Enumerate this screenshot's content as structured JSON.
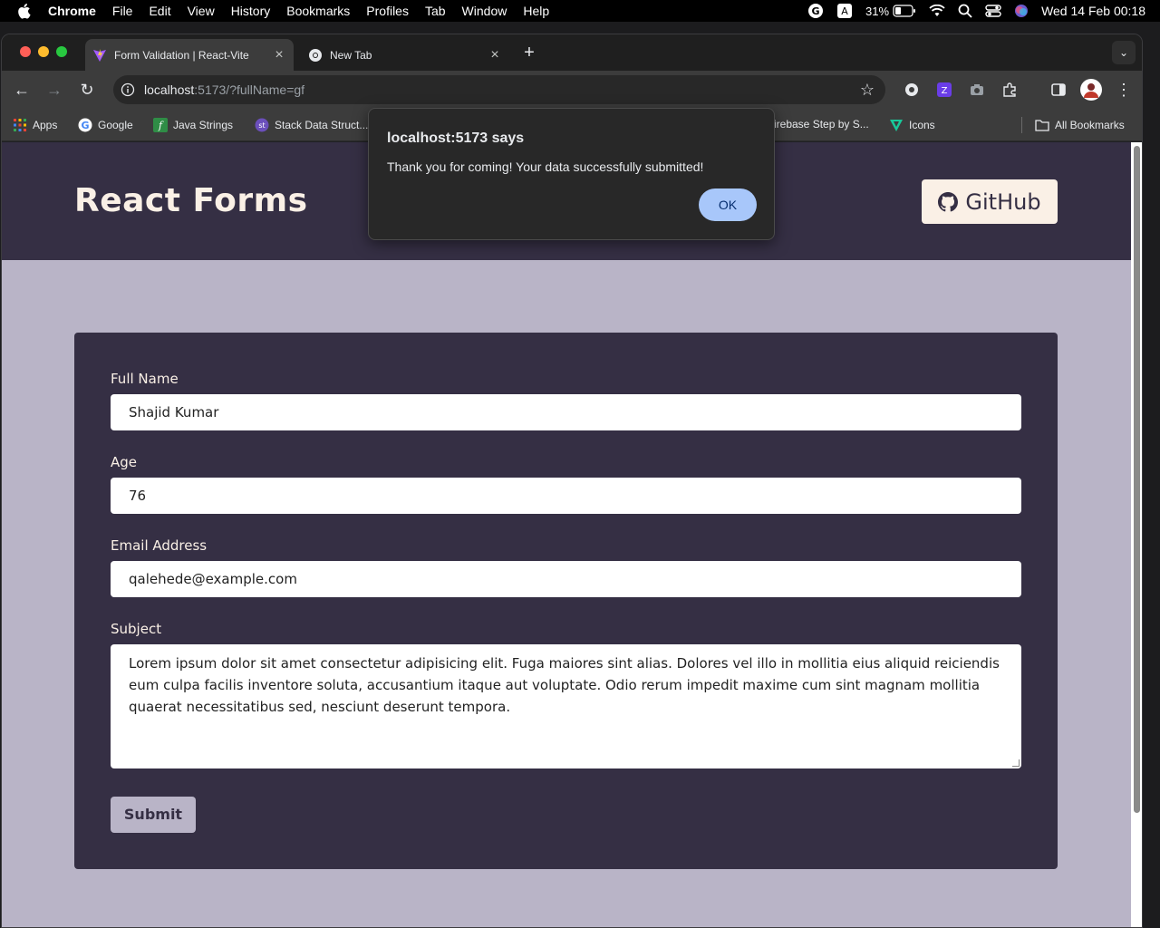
{
  "menubar": {
    "app_name": "Chrome",
    "menus": [
      "File",
      "Edit",
      "View",
      "History",
      "Bookmarks",
      "Profiles",
      "Tab",
      "Window",
      "Help"
    ],
    "battery": "31%",
    "clock": "Wed 14 Feb  00:18"
  },
  "browser": {
    "tabs": [
      {
        "title": "Form Validation | React-Vite",
        "active": true
      },
      {
        "title": "New Tab",
        "active": false
      }
    ],
    "url_host": "localhost",
    "url_rest": ":5173/?fullName=gf",
    "bookmarks": [
      "Apps",
      "Google",
      "Java Strings",
      "Stack Data Struct...",
      "irebase Step by S...",
      "Icons"
    ],
    "all_bookmarks": "All Bookmarks"
  },
  "page": {
    "brand": "React Forms",
    "github_label": "GitHub",
    "form": {
      "full_name_label": "Full Name",
      "full_name_value": "Shajid Kumar",
      "age_label": "Age",
      "age_value": "76",
      "email_label": "Email Address",
      "email_value": "qalehede@example.com",
      "subject_label": "Subject",
      "subject_value": "Lorem ipsum dolor sit amet consectetur adipisicing elit. Fuga maiores sint alias. Dolores vel illo in mollitia eius aliquid reiciendis eum culpa facilis inventore soluta, accusantium itaque aut voluptate. Odio rerum impedit maxime cum sint magnam mollitia quaerat necessitatibus sed, nesciunt deserunt tempora.",
      "submit_label": "Submit"
    }
  },
  "dialog": {
    "title": "localhost:5173 says",
    "message": "Thank you for coming! Your data successfully submitted!",
    "ok_label": "OK"
  },
  "colors": {
    "header_bg": "#352f44",
    "page_bg": "#b9b4c7",
    "cream": "#faf0e6",
    "ok_button": "#a8c7fa"
  }
}
